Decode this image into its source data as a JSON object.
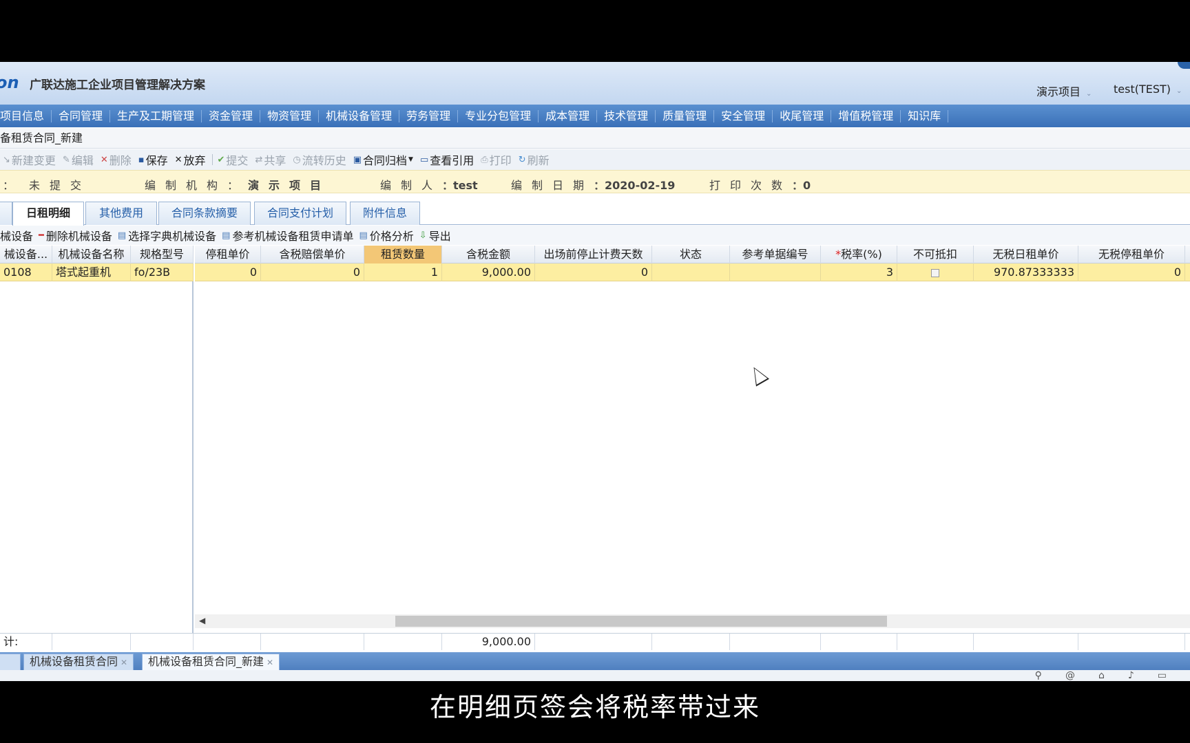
{
  "header": {
    "logo": "on",
    "title": "广联达施工企业项目管理解决方案",
    "project": "演示项目",
    "user": "test(TEST)"
  },
  "menu": [
    "项目信息",
    "合同管理",
    "生产及工期管理",
    "资金管理",
    "物资管理",
    "机械设备管理",
    "劳务管理",
    "专业分包管理",
    "成本管理",
    "技术管理",
    "质量管理",
    "安全管理",
    "收尾管理",
    "增值税管理",
    "知识库"
  ],
  "page_title": "备租赁合同_新建",
  "toolbar": [
    {
      "label": "新建变更",
      "icon": "new-change-icon",
      "enabled": false
    },
    {
      "label": "编辑",
      "icon": "edit-icon",
      "enabled": false
    },
    {
      "label": "删除",
      "icon": "delete-icon",
      "enabled": false
    },
    {
      "label": "保存",
      "icon": "save-icon",
      "enabled": true
    },
    {
      "label": "放弃",
      "icon": "discard-icon",
      "enabled": true
    },
    {
      "label": "提交",
      "icon": "submit-icon",
      "enabled": false
    },
    {
      "label": "共享",
      "icon": "share-icon",
      "enabled": false
    },
    {
      "label": "流转历史",
      "icon": "history-icon",
      "enabled": false
    },
    {
      "label": "合同归档",
      "icon": "archive-icon",
      "enabled": true
    },
    {
      "label": "查看引用",
      "icon": "reference-icon",
      "enabled": true
    },
    {
      "label": "打印",
      "icon": "print-icon",
      "enabled": false
    },
    {
      "label": "刷新",
      "icon": "refresh-icon",
      "enabled": false
    }
  ],
  "info": {
    "status_label": "：",
    "status_value": "未提交",
    "org_label": "编制机构",
    "org_value": "演示项目",
    "author_label": "编制人",
    "author_value": "test",
    "date_label": "编制日期",
    "date_value": "2020-02-19",
    "print_label": "打印次数",
    "print_value": "0"
  },
  "tabs": [
    "日租明细",
    "其他费用",
    "合同条款摘要",
    "合同支付计划",
    "附件信息"
  ],
  "subtoolbar": [
    "械设备",
    "删除机械设备",
    "选择字典机械设备",
    "参考机械设备租赁申请单",
    "价格分析",
    "导出"
  ],
  "left_columns": [
    "械设备...",
    "机械设备名称",
    "规格型号"
  ],
  "left_row": [
    "0108",
    "塔式起重机",
    "fo/23B"
  ],
  "right_columns": [
    "停租单价",
    "含税赔偿单价",
    "租赁数量",
    "含税金额",
    "出场前停止计费天数",
    "状态",
    "参考单据编号",
    "税率(%)",
    "不可抵扣",
    "无税日租单价",
    "无税停租单价"
  ],
  "required_mark": "*",
  "right_row": [
    "0",
    "0",
    "1",
    "9,000.00",
    "0",
    "",
    "",
    "3",
    "",
    "970.87333333",
    "0"
  ],
  "totals": {
    "label": "计:",
    "amount": "9,000.00"
  },
  "bottom_tabs": [
    {
      "label": "机械设备租赁合同",
      "active": false
    },
    {
      "label": "机械设备租赁合同_新建",
      "active": true
    }
  ],
  "subtitle": "在明细页签会将税率带过来",
  "colors": {
    "menubar": "#3a70b8",
    "row_highlight": "#fdeea1",
    "header_highlight": "#f3c776"
  }
}
